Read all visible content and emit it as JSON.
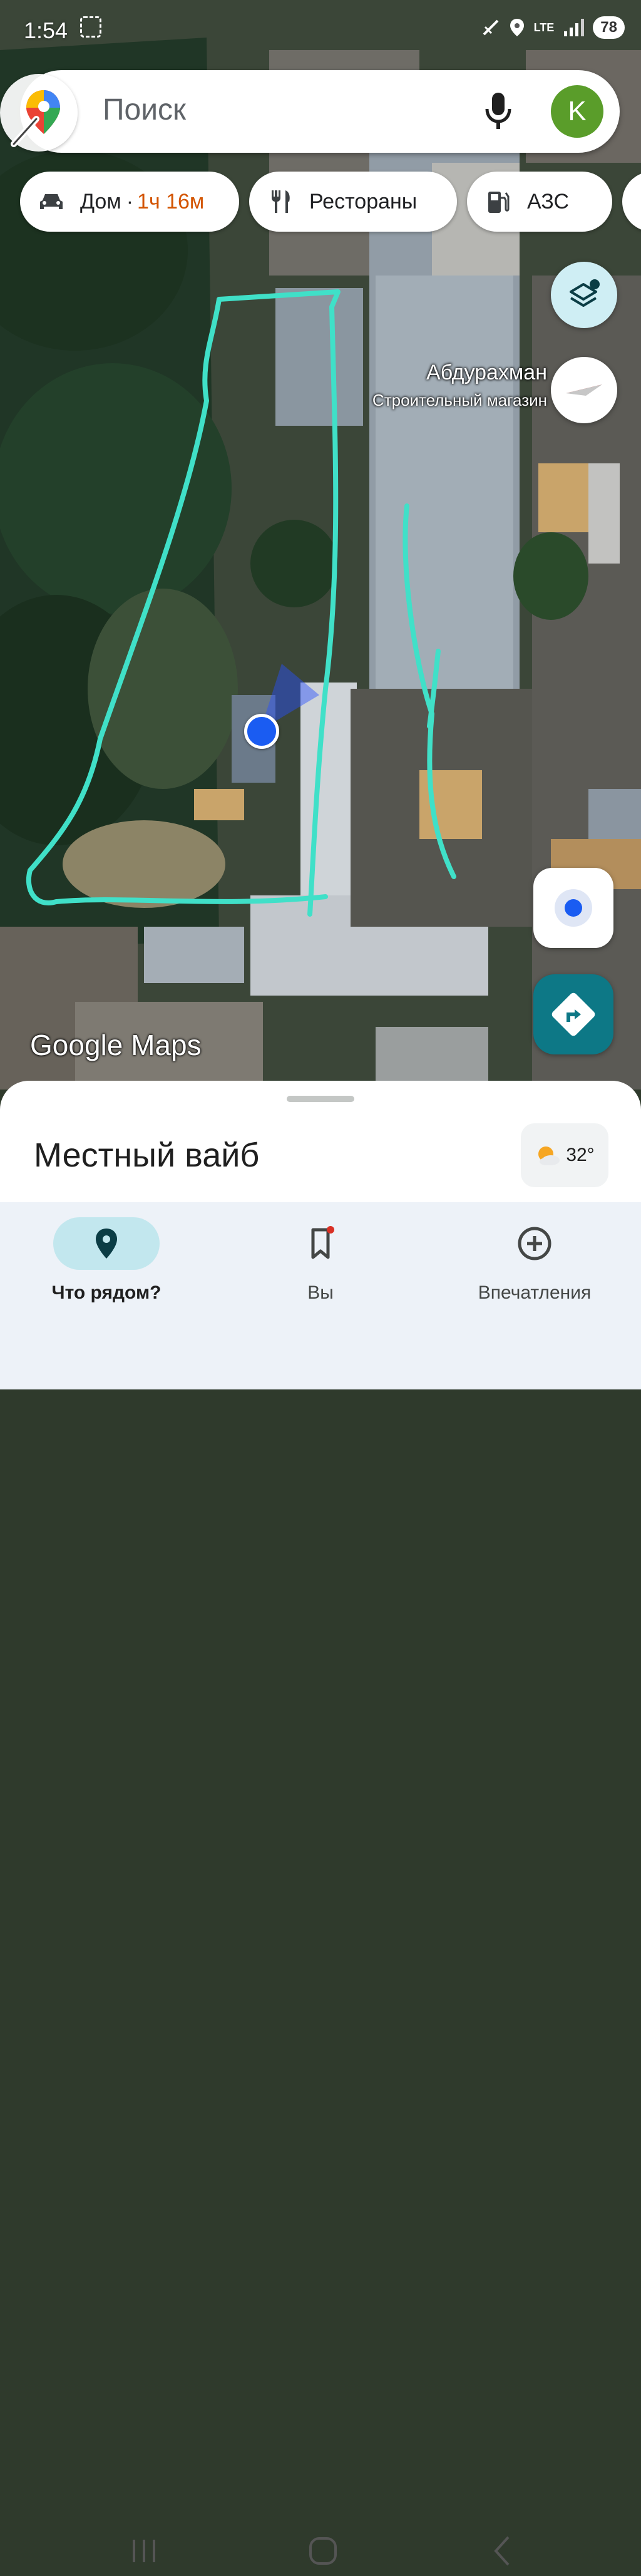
{
  "status_bar": {
    "time": "1:54",
    "network": "LTE",
    "battery": "78"
  },
  "search": {
    "placeholder": "Поиск",
    "avatar_letter": "K"
  },
  "chips": [
    {
      "icon": "car-icon",
      "label": "Дом",
      "separator": "·",
      "eta": "1ч 16м"
    },
    {
      "icon": "fork-knife-icon",
      "label": "Рестораны"
    },
    {
      "icon": "gas-station-icon",
      "label": "АЗС"
    },
    {
      "icon": "hotel-bed-icon",
      "label": ""
    }
  ],
  "map": {
    "place_name": "Абдурахман",
    "place_category": "Строительный магазин",
    "attribution": "Google Maps",
    "colors": {
      "drawing": "#40e0c8",
      "location_dot": "#1a5cf2",
      "accent": "#0d7886"
    }
  },
  "sheet": {
    "title": "Местный вайб",
    "weather_temp": "32°"
  },
  "bottom_nav": [
    {
      "icon": "location-pin-icon",
      "label": "Что рядом?",
      "active": true
    },
    {
      "icon": "bookmark-icon",
      "label": "Вы",
      "active": false,
      "badge": true
    },
    {
      "icon": "add-circle-icon",
      "label": "Впечатления",
      "active": false
    }
  ]
}
